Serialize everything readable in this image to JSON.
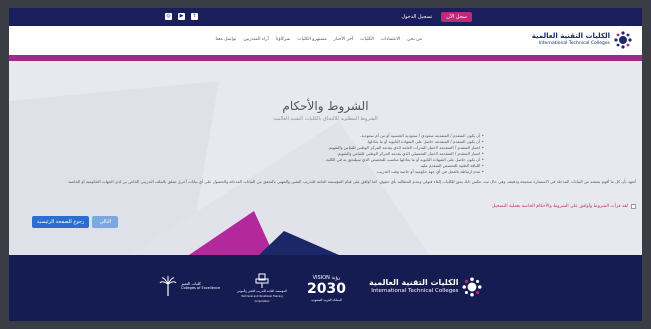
{
  "topbar": {
    "register_label": "سجل الآن",
    "login_label": "تسجيل الدخول",
    "social_icons": [
      "instagram-icon",
      "youtube-icon",
      "twitter-icon"
    ]
  },
  "logo": {
    "ar": "الكليات التقنية العالمية",
    "en": "International Technical Colleges"
  },
  "nav": {
    "items": [
      "من نحن",
      "الاعتمادات",
      "الكليات",
      "آخر الأخبار",
      "مشتهرو الكليات",
      "شركاؤنا",
      "آراء المتدربين",
      "تواصل معنا"
    ]
  },
  "page": {
    "title": "الشروط والأحكام",
    "subtitle": "الشروط المطلوبة للالتحاق بالكليات التقنية العالمية",
    "terms": [
      "أن يكون المتقدم / المتقدمة سعودي / سعودية الجنسية أو من أم سعودية.",
      "أن يكون المتقدم / المتقدمة حاصل على الشهادة الثانوية أو ما يعادلها.",
      "اجتياز المتقدم / المتقدمة لاختبار القدرات العامة الذي يقدمه المركز الوطني للقياس والتقويم.",
      "اجتياز المتقدم / المتقدمة لاختبار التحصيلي الذي يقدمه المركز الوطني للقياس والتقويم.",
      "أن يكون حاصل على الشهادة الثانوية أو ما يعادلها مناسب للتخصص الذي سيلتحق به في الكلية.",
      "اللياقة الطبية للتخصص المتقدم عليه.",
      "عدم ارتباطه بالعمل في أي جهة حكومية أو خاصة وقت التدريب."
    ],
    "paragraph": "أتعهد بأن كل ما أقوم بتعبئته من البيانات المدخلة في الاستمارة صحيحة ودقيقة، وفي حال ثبت عكس ذلك يحق للكليات إلغاء قبولي وعدم المطالبة بأي حقوق، كما أوافق على قيام المؤسسة العامة للتدريب التقني والمهني بالتحقق من البيانات المدخلة والحصول على أي بيانات أخرى تتعلق بالملف التدريبي الخاص بي لدى الجهات الحكومية أو الخاصة.",
    "agree_label": "لقد قرأت الشروط وأوافق على الشروط والأحكام الخاصة بعملية التسجيل",
    "next_label": "التالي",
    "home_label": "رجوع للصفحة الرئيسية"
  },
  "footer": {
    "itc_ar": "الكليات التقنية العالمية",
    "itc_en": "International Technical Colleges",
    "vision_label": "VISION رؤية",
    "vision_year": "2030",
    "vision_sub": "المملكة العربية السعودية",
    "tvtc_ar": "المؤسسة العامة للتدريب التقني والمهني",
    "tvtc_en": "Technical and Vocational Training Corporation",
    "excellence_ar": "كليات التميز",
    "excellence_en": "Colleges of Excellence"
  },
  "colors": {
    "navy": "#141c52",
    "magenta": "#c0287a",
    "purple": "#9b2a8b",
    "blue": "#2a6fd0"
  }
}
